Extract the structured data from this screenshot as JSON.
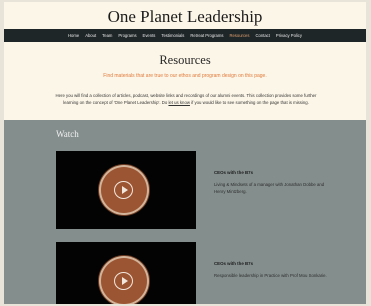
{
  "site": {
    "title": "One Planet Leadership"
  },
  "nav": {
    "items": [
      "Home",
      "About",
      "Team",
      "Programs",
      "Events",
      "Testimonials",
      "Retreat Programs",
      "Resources",
      "Contact",
      "Privacy Policy"
    ],
    "active": "Resources"
  },
  "page": {
    "title": "Resources",
    "subtitle": "Find materials that are true to our ethos and program design on this page.",
    "intro_before_link": "Here you will find a collection of articles, podcast, website links and recordings of our alumni events. This collection provides some further learning on the concept of 'One Planet Leadership'. Do ",
    "intro_link": "let us know",
    "intro_after_link": " if you would like to see something on the page that is missing."
  },
  "watch": {
    "heading": "Watch",
    "videos": [
      {
        "title": "CEOs with the B7s",
        "description": "Living & Mindsets of a manager with Jonathan Dobbe and Henry Mintzberg."
      },
      {
        "title": "CEOs with the B7s",
        "description": "Responsible leadership in Practice with Prof Mou Sonkarie."
      }
    ]
  },
  "colors": {
    "nav_bg": "#1f2628",
    "accent": "#e07a3a",
    "watch_bg": "#848e8d",
    "page_bg": "#fcf6e8"
  }
}
